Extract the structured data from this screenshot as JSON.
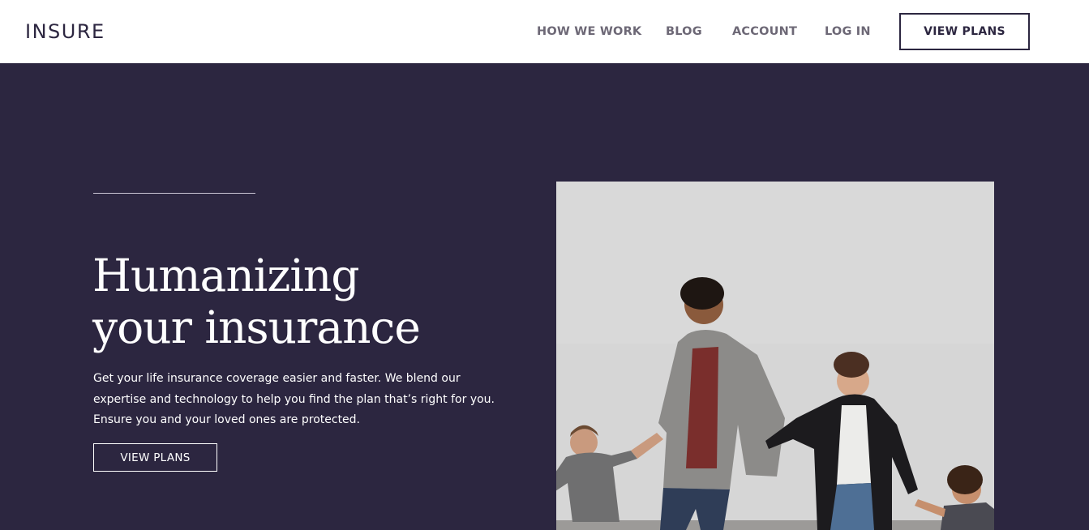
{
  "header": {
    "logo": "INSURE",
    "nav": [
      {
        "label": "HOW WE WORK"
      },
      {
        "label": "BLOG"
      },
      {
        "label": "ACCOUNT"
      },
      {
        "label": "LOG IN"
      }
    ],
    "cta_label": "VIEW PLANS"
  },
  "hero": {
    "title_line1": "Humanizing",
    "title_line2": "your insurance",
    "text_line1": "Get your life insurance coverage easier and faster. We blend our",
    "text_line2": "expertise and technology to help you find the plan that’s right for you.",
    "text_line3": "Ensure you and your loved ones are protected.",
    "cta_label": "VIEW PLANS",
    "photo_icon": "family-photo"
  },
  "colors": {
    "brand_dark": "#2c2640",
    "nav_text": "#6d6876",
    "header_bg": "#ffffff"
  }
}
